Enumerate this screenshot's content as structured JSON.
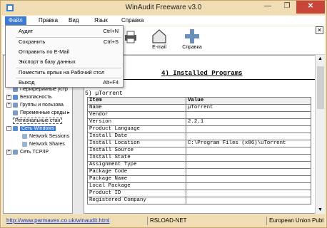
{
  "app": {
    "title": "WinAudit Freeware v3.0"
  },
  "window_controls": {
    "minimize": "—",
    "maximize": "❐",
    "close": "✕"
  },
  "menubar": {
    "file": "Файл",
    "edit": "Правка",
    "view": "Вид",
    "language": "Язык",
    "help": "Справка"
  },
  "file_menu": [
    {
      "label": "Аудит",
      "shortcut": "Ctrl+N"
    },
    {
      "label": "Сохранить",
      "shortcut": "Ctrl+S"
    },
    {
      "label": "Отправить по E-Mail",
      "shortcut": ""
    },
    {
      "label": "Экспорт в базу данных",
      "shortcut": ""
    },
    {
      "label": "Поместить ярлык на Рабочий стол",
      "shortcut": ""
    },
    {
      "label": "Выход",
      "shortcut": "Alt+F4"
    }
  ],
  "toolbar": {
    "email_label": "E-mail",
    "help_label": "Справка"
  },
  "tree": [
    {
      "label": "Периферийные устр",
      "expand": ""
    },
    {
      "label": "Безопасность",
      "expand": "+"
    },
    {
      "label": "Группы и пользова",
      "expand": "+"
    },
    {
      "label": "Переменные среды",
      "expand": ""
    },
    {
      "label": "Региональные стан",
      "expand": ""
    },
    {
      "label": "Сеть Windows",
      "expand": "-"
    },
    {
      "label": "Network Sessions",
      "expand": ""
    },
    {
      "label": "Network Shares",
      "expand": ""
    },
    {
      "label": "Сеть TCP/IP",
      "expand": "+"
    }
  ],
  "content": {
    "section_title": "4) Installed Programs",
    "subheading": "5) µTorrent",
    "columns": [
      "Item",
      "Value"
    ],
    "rows": [
      [
        "Name",
        "µTorrent"
      ],
      [
        "Vendor",
        ""
      ],
      [
        "Version",
        "2.2.1"
      ],
      [
        "Product Language",
        ""
      ],
      [
        "Install Date",
        ""
      ],
      [
        "Install Location",
        "C:\\Program Files (x86)\\uTorrent"
      ],
      [
        "Install Source",
        ""
      ],
      [
        "Install State",
        ""
      ],
      [
        "Assignment Type",
        ""
      ],
      [
        "Package Code",
        ""
      ],
      [
        "Package Name",
        ""
      ],
      [
        "Local Package",
        ""
      ],
      [
        "Product ID",
        ""
      ],
      [
        "Registered Company",
        ""
      ]
    ]
  },
  "statusbar": {
    "url": "http://www.parmavex.co.uk/winaudit.html",
    "center": "RSLOAD-NET",
    "right": "European Union Publ"
  },
  "colors": {
    "accent": "#3a7bd5",
    "chrome": "#f1ddb3",
    "close": "#c9453a"
  }
}
